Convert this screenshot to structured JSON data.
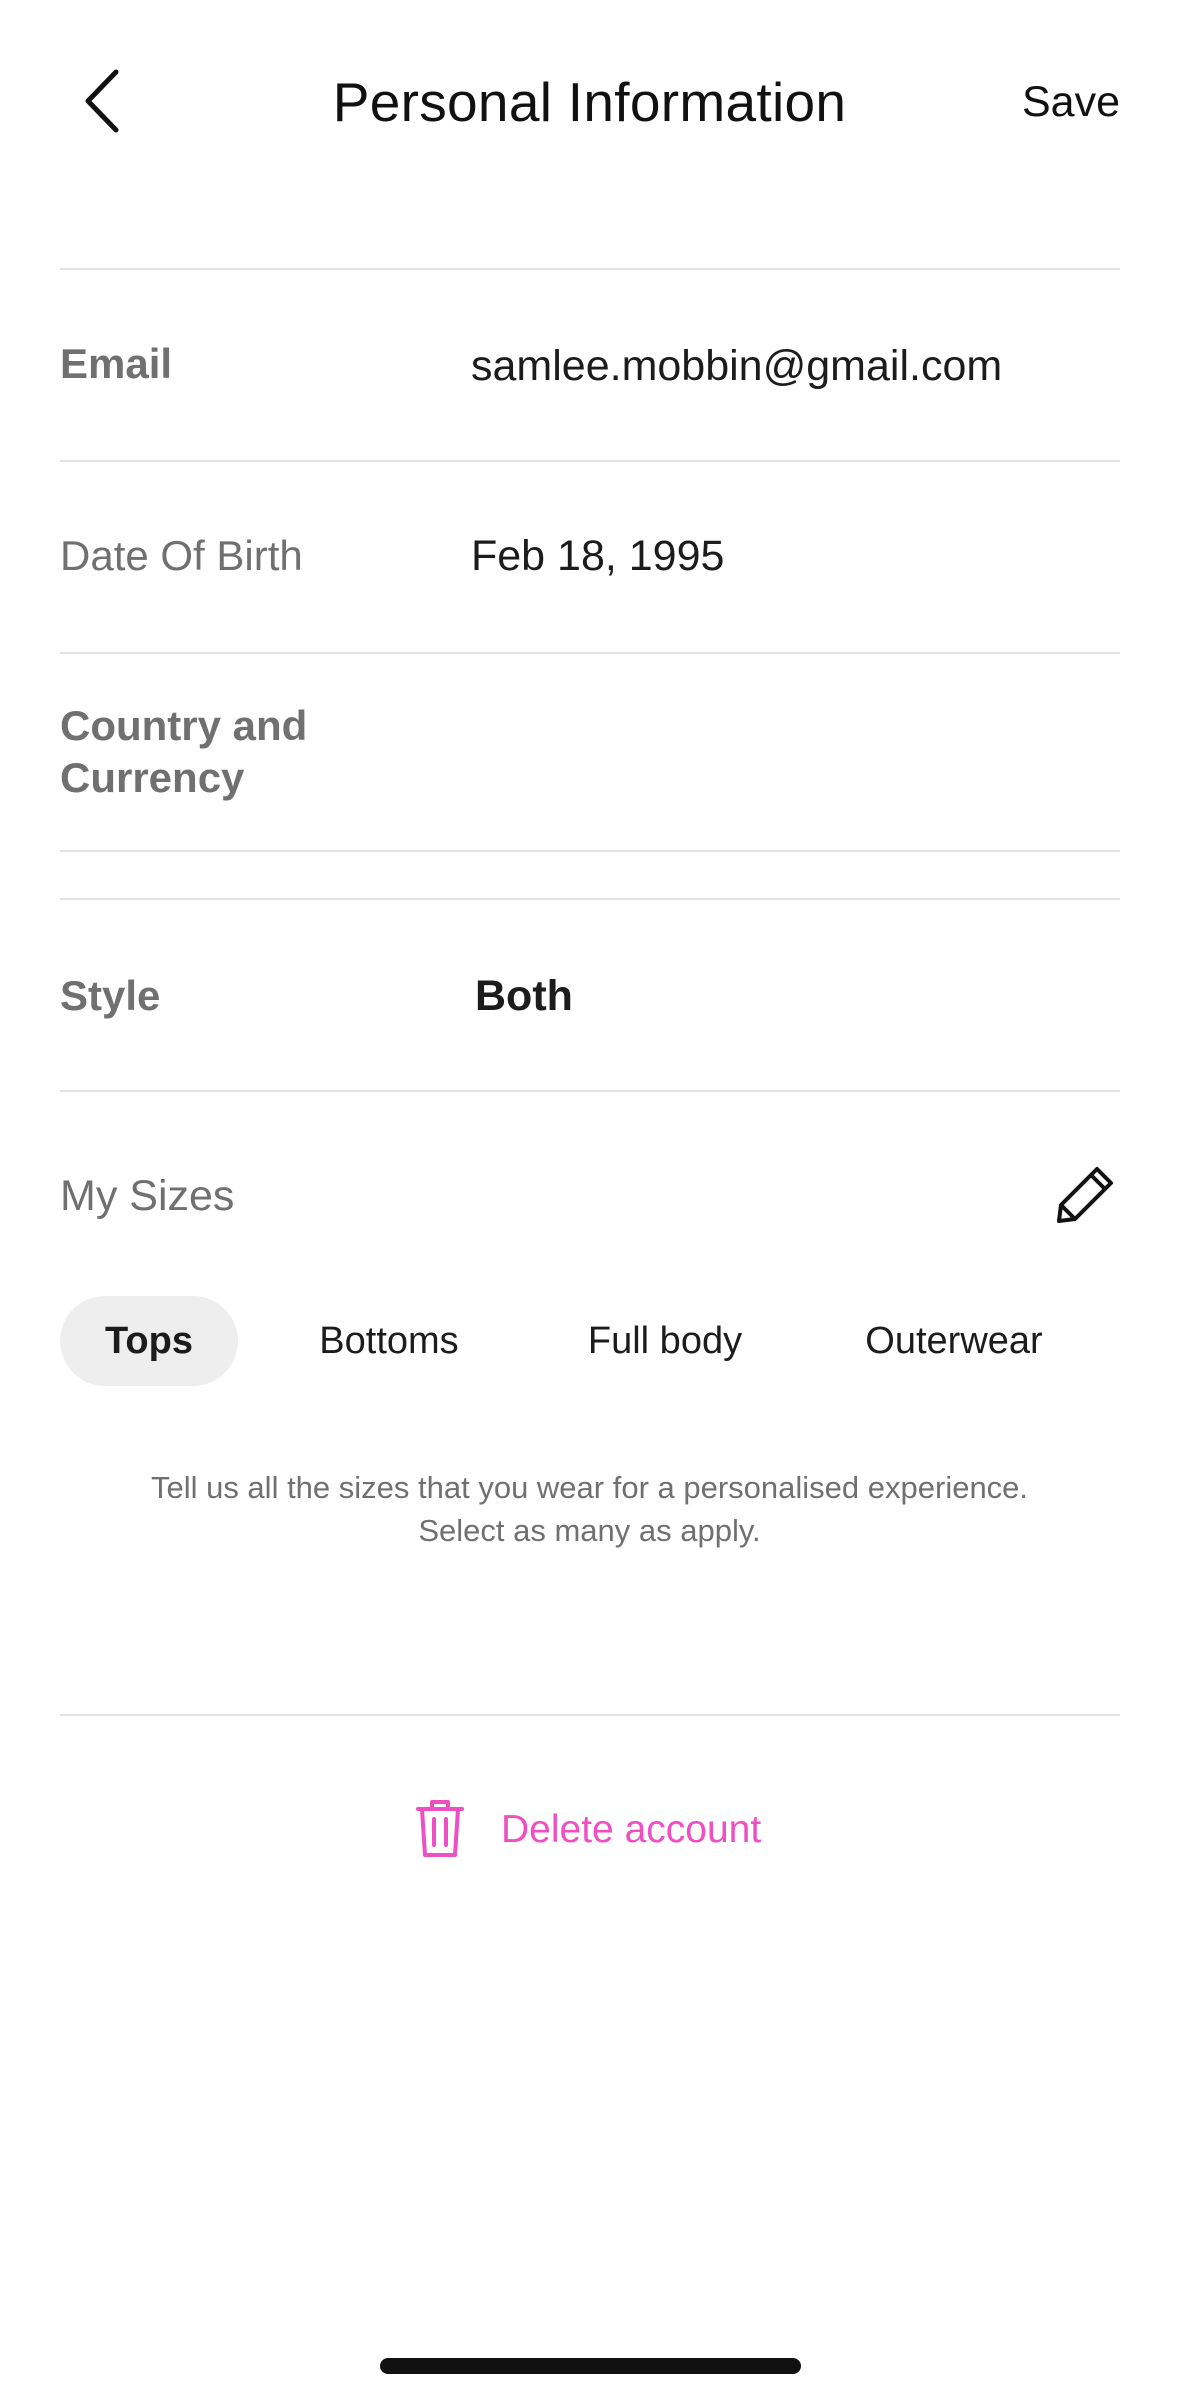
{
  "header": {
    "title": "Personal Information",
    "save_label": "Save",
    "back_icon": "chevron-left-icon"
  },
  "fields": {
    "email": {
      "label": "Email",
      "value": "samlee.mobbin@gmail.com"
    },
    "dob": {
      "label": "Date Of Birth",
      "value": "Feb 18, 1995"
    },
    "country": {
      "label_line1": "Country and",
      "label_line2": "Currency",
      "value": ""
    },
    "style": {
      "label": "Style",
      "value": "Both"
    }
  },
  "sizes": {
    "label": "My Sizes",
    "edit_icon": "pencil-icon",
    "tabs": [
      {
        "label": "Tops",
        "active": true
      },
      {
        "label": "Bottoms",
        "active": false
      },
      {
        "label": "Full body",
        "active": false
      },
      {
        "label": "Outerwear",
        "active": false
      }
    ],
    "helper_line1": "Tell us all the sizes that you wear for a personalised experience.",
    "helper_line2": "Select as many as apply."
  },
  "delete": {
    "label": "Delete account",
    "icon": "trash-icon",
    "color": "#ee4fc2"
  },
  "colors": {
    "text_primary": "#111111",
    "text_secondary": "#707070",
    "divider": "#e1e1e1",
    "tab_active_bg": "#eeeeee"
  }
}
